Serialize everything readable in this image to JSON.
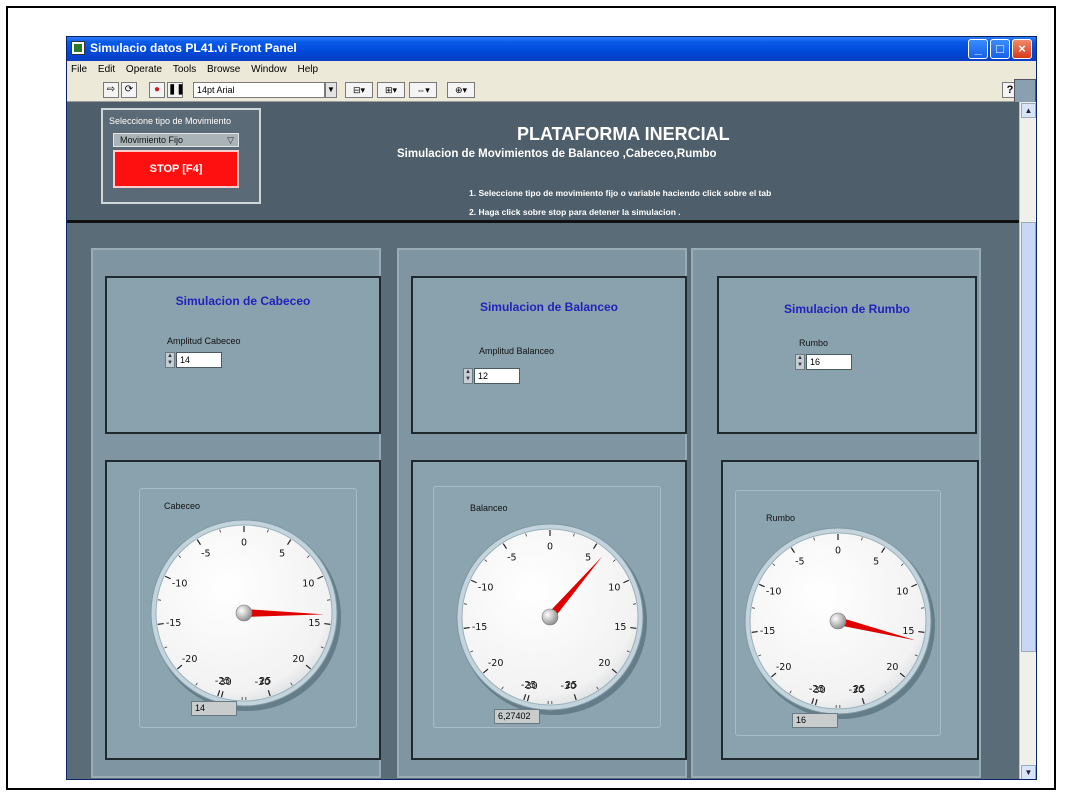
{
  "window": {
    "title": "Simulacio datos PL41.vi Front Panel"
  },
  "menu": [
    "File",
    "Edit",
    "Operate",
    "Tools",
    "Browse",
    "Window",
    "Help"
  ],
  "toolbar": {
    "font": "14pt Arial",
    "help": "?"
  },
  "header": {
    "move_label": "Seleccione tipo de Movimiento",
    "move_value": "Movimiento Fijo",
    "stop_label": "STOP [F4]",
    "title": "PLATAFORMA INERCIAL",
    "subtitle": "Simulacion de Movimientos de Balanceo ,Cabeceo,Rumbo",
    "instruction1": "1. Seleccione tipo de movimiento fijo o variable  haciendo click sobre el tab",
    "instruction2": "2. Haga click sobre stop para detener la simulacion ."
  },
  "gauge_ticks": [
    "-5",
    "0",
    "5",
    "10",
    "15",
    "20",
    "25",
    "30",
    "-30",
    "-25",
    "-20",
    "-15",
    "-10"
  ],
  "sims": [
    {
      "title": "Simulacion de Cabeceo",
      "input_label": "Amplitud Cabeceo",
      "input_value": "14",
      "gauge_label": "Cabeceo",
      "value": 14,
      "indicator": "14"
    },
    {
      "title": "Simulacion de Balanceo",
      "input_label": "Amplitud Balanceo",
      "input_value": "12",
      "gauge_label": "Balanceo",
      "value": 6.27402,
      "indicator": "6,27402"
    },
    {
      "title": "Simulacion de Rumbo",
      "input_label": "Rumbo",
      "input_value": "16",
      "gauge_label": "Rumbo",
      "value": 16,
      "indicator": "16"
    }
  ],
  "colors": {
    "needle": "#e00000",
    "stop": "#ff1010",
    "title_blue": "#2222bb"
  }
}
